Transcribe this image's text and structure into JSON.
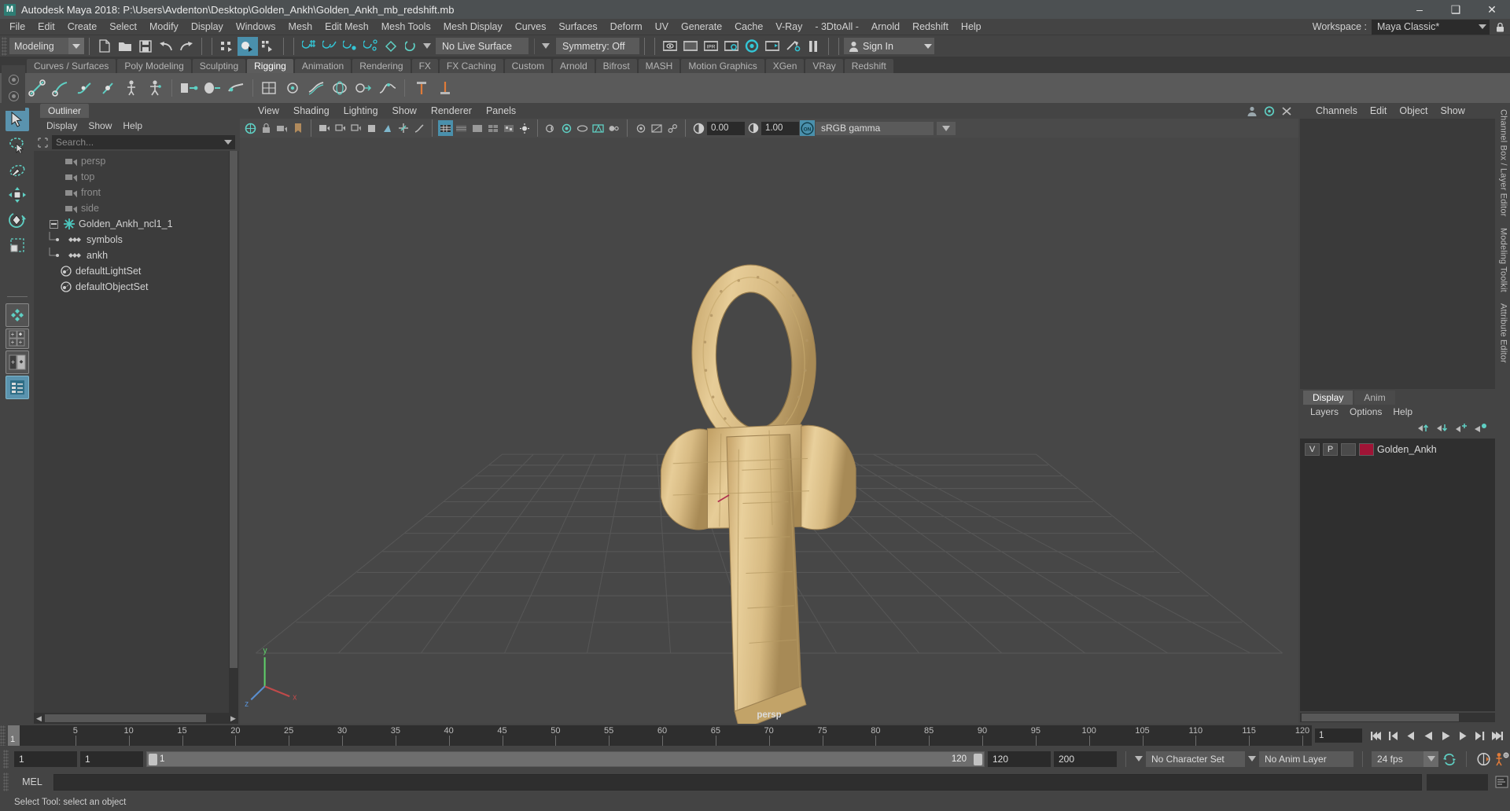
{
  "window": {
    "title": "Autodesk Maya 2018: P:\\Users\\Avdenton\\Desktop\\Golden_Ankh\\Golden_Ankh_mb_redshift.mb",
    "logo_text": "M",
    "minimize": "–",
    "maximize": "❑",
    "close": "✕"
  },
  "menubar": {
    "items": [
      "File",
      "Edit",
      "Create",
      "Select",
      "Modify",
      "Display",
      "Windows",
      "Mesh",
      "Edit Mesh",
      "Mesh Tools",
      "Mesh Display",
      "Curves",
      "Surfaces",
      "Deform",
      "UV",
      "Generate",
      "Cache",
      "V-Ray",
      "- 3DtoAll -",
      "Arnold",
      "Redshift",
      "Help"
    ],
    "workspace_label": "Workspace :",
    "workspace_value": "Maya Classic*",
    "lock_icon": "lock-icon"
  },
  "statusline": {
    "menu_set": "Modeling",
    "live_surface": "No Live Surface",
    "symmetry": "Symmetry: Off",
    "sign_in": "Sign In",
    "icons": [
      "new-scene-icon",
      "open-scene-icon",
      "save-scene-icon",
      "undo-icon",
      "redo-icon",
      "select-hierarchy-icon",
      "select-object-icon",
      "select-component-icon",
      "snap-grid-icon",
      "snap-curve-icon",
      "snap-point-icon",
      "snap-projected-icon",
      "snap-view-plane-icon",
      "make-live-icon",
      "render-view-icon",
      "render-region-icon",
      "ipr-render-icon",
      "render-settings-icon",
      "hypershade-icon",
      "render-setup-icon",
      "light-linking-icon",
      "pause-icon"
    ]
  },
  "shelf": {
    "tabs": [
      "Curves / Surfaces",
      "Poly Modeling",
      "Sculpting",
      "Rigging",
      "Animation",
      "Rendering",
      "FX",
      "FX Caching",
      "Custom",
      "Arnold",
      "Bifrost",
      "MASH",
      "Motion Graphics",
      "XGen",
      "VRay",
      "Redshift"
    ],
    "active_tab": "Rigging",
    "buttons": [
      "create-joint-icon",
      "ik-handle-icon",
      "ik-spline-icon",
      "insert-joint-icon",
      "quick-rig-icon",
      "human-ik-icon",
      "bind-skin-icon",
      "interactive-bind-icon",
      "smooth-bind-icon",
      "lattice-icon",
      "cluster-icon",
      "wire-icon",
      "wrap-icon",
      "blend-shape-icon",
      "soft-modification-icon",
      "constraint-parent-icon",
      "constraint-point-icon"
    ]
  },
  "toolbox": {
    "tools": [
      {
        "name": "select-tool",
        "selected": true
      },
      {
        "name": "lasso-select-tool",
        "selected": false
      },
      {
        "name": "paint-select-tool",
        "selected": false
      },
      {
        "name": "move-tool",
        "selected": false
      },
      {
        "name": "rotate-tool",
        "selected": false
      },
      {
        "name": "scale-tool",
        "selected": false
      },
      {
        "name": "last-tool",
        "selected": false
      }
    ],
    "layouts": [
      {
        "name": "single-pane-layout",
        "selected": false
      },
      {
        "name": "four-pane-layout",
        "selected": false
      },
      {
        "name": "two-pane-split-layout",
        "selected": false
      },
      {
        "name": "persp-outliner-layout",
        "selected": true
      }
    ]
  },
  "outliner": {
    "tab": "Outliner",
    "menus": [
      "Display",
      "Show",
      "Help"
    ],
    "search_placeholder": "Search...",
    "filter_icon": "filter-icon",
    "items": [
      {
        "label": "persp",
        "icon": "camera-icon",
        "depth": 1,
        "dim": true,
        "expander": null
      },
      {
        "label": "top",
        "icon": "camera-icon",
        "depth": 1,
        "dim": true,
        "expander": null
      },
      {
        "label": "front",
        "icon": "camera-icon",
        "depth": 1,
        "dim": true,
        "expander": null
      },
      {
        "label": "side",
        "icon": "camera-icon",
        "depth": 1,
        "dim": true,
        "expander": null
      },
      {
        "label": "Golden_Ankh_ncl1_1",
        "icon": "transform-icon",
        "depth": 0,
        "dim": false,
        "expander": "minus"
      },
      {
        "label": "symbols",
        "icon": "mesh-icon",
        "depth": 2,
        "dim": false,
        "expander": null
      },
      {
        "label": "ankh",
        "icon": "mesh-icon",
        "depth": 2,
        "dim": false,
        "expander": null
      },
      {
        "label": "defaultLightSet",
        "icon": "set-icon",
        "depth": 1,
        "dim": false,
        "expander": null
      },
      {
        "label": "defaultObjectSet",
        "icon": "set-icon",
        "depth": 1,
        "dim": false,
        "expander": null
      }
    ]
  },
  "viewport": {
    "menus": [
      "View",
      "Shading",
      "Lighting",
      "Show",
      "Renderer",
      "Panels"
    ],
    "camera_label": "persp",
    "exposure_value": "0.00",
    "gamma_value": "1.00",
    "color_management": "sRGB gamma",
    "view_gate_icon": "camera-gate-icon",
    "grid_color": "#5a5a5a",
    "background_color": "#474747",
    "model_color": "#dcc183",
    "axis_labels": [
      "x",
      "y",
      "z"
    ]
  },
  "channelbox": {
    "menus": [
      "Channels",
      "Edit",
      "Object",
      "Show"
    ],
    "vertical_tabs": [
      "Channel Box / Layer Editor",
      "Modeling Toolkit",
      "Attribute Editor"
    ]
  },
  "layers": {
    "tabs": [
      "Display",
      "Anim"
    ],
    "active_tab": "Display",
    "menus": [
      "Layers",
      "Options",
      "Help"
    ],
    "buttons": [
      "move-layer-up-icon",
      "move-layer-down-icon",
      "new-layer-from-selected-icon",
      "new-layer-icon"
    ],
    "rows": [
      {
        "visibility": "V",
        "playback": "P",
        "shading": "",
        "color": "#a01436",
        "name": "Golden_Ankh"
      }
    ]
  },
  "timeline": {
    "current_frame": "1",
    "start_label": "1",
    "ticks": [
      5,
      10,
      15,
      20,
      25,
      30,
      35,
      40,
      45,
      50,
      55,
      60,
      65,
      70,
      75,
      80,
      85,
      90,
      95,
      100,
      105,
      110,
      115,
      120
    ],
    "max": 120,
    "playback_field": "1",
    "playback_buttons": [
      "go-to-start-icon",
      "step-back-key-icon",
      "step-back-frame-icon",
      "play-backwards-icon",
      "play-forwards-icon",
      "step-forward-frame-icon",
      "step-forward-key-icon",
      "go-to-end-icon"
    ]
  },
  "rangebar": {
    "anim_start": "1",
    "range_start": "1",
    "range_slider_start": "1",
    "range_slider_end": "120",
    "range_end": "120",
    "anim_end": "200",
    "character_set": "No Character Set",
    "anim_layer": "No Anim Layer",
    "fps": "24 fps",
    "loop_icon": "loop-icon",
    "auto_key_icon": "auto-keyframe-icon",
    "prefs_icon": "animation-preferences-icon"
  },
  "command": {
    "label": "MEL",
    "input_value": "",
    "script_editor_icon": "script-editor-icon"
  },
  "status": {
    "message": "Select Tool: select an object"
  }
}
